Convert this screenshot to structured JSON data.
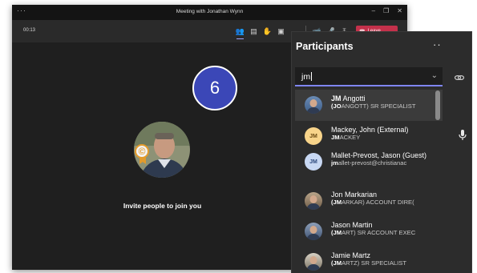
{
  "window": {
    "title": "Meeting with Jonathan Wynn",
    "menu_glyph": "···",
    "controls": [
      "–",
      "❐",
      "✕"
    ]
  },
  "toolbar": {
    "timer": "00:13",
    "tools": [
      {
        "icon": "participants-icon",
        "glyph": "👥",
        "active": true
      },
      {
        "icon": "chat-icon",
        "glyph": "▤"
      },
      {
        "icon": "raise-hand-icon",
        "glyph": "✋"
      },
      {
        "icon": "share-tray-icon",
        "glyph": "▣"
      },
      {
        "icon": "more-options-icon",
        "glyph": "···"
      }
    ],
    "device_tools": [
      {
        "icon": "camera-off-icon",
        "glyph": "📹"
      },
      {
        "icon": "microphone-icon",
        "glyph": "🎤"
      },
      {
        "icon": "share-screen-icon",
        "glyph": "⤒"
      }
    ],
    "leave_label": "Leave",
    "leave_color": "#c4314b"
  },
  "stage": {
    "invite_text": "Invite people to join you",
    "step_number": "6",
    "step_color": "#3b47b7"
  },
  "participants_panel": {
    "title": "Participants",
    "more_glyph": "···",
    "close_glyph": "✕",
    "search_value": "jm",
    "accent_color": "#7f85f5",
    "results": [
      {
        "avatar": "photo1",
        "name_bold": "JM",
        "name_rest": " Angotti",
        "sub_bold": "(JO",
        "sub_rest": "ANGOTT) SR SPECIALIST",
        "selected": true
      },
      {
        "avatar": "init-y",
        "initials": "JM",
        "name_bold": "",
        "name_rest": "Mackey, John (External)",
        "sub_bold": "JM",
        "sub_rest": "ACKEY"
      },
      {
        "avatar": "init-b",
        "initials": "JM",
        "name_bold": "",
        "name_rest": "Mallet-Prevost, Jason (Guest)",
        "sub_bold": "jm",
        "sub_rest": "allet-prevost@christianac"
      },
      {
        "avatar": "photo2",
        "name_bold": "",
        "name_rest": "Jon Markarian",
        "sub_bold": "(JM",
        "sub_rest": "ARKAR) ACCOUNT DIRE("
      },
      {
        "avatar": "photo3",
        "name_bold": "",
        "name_rest": "Jason Martin",
        "sub_bold": "(JM",
        "sub_rest": "ART) SR ACCOUNT EXEC"
      },
      {
        "avatar": "photo4",
        "name_bold": "",
        "name_rest": "Jamie Martz",
        "sub_bold": "(JM",
        "sub_rest": "ARTZ) SR SPECIALIST"
      }
    ]
  }
}
